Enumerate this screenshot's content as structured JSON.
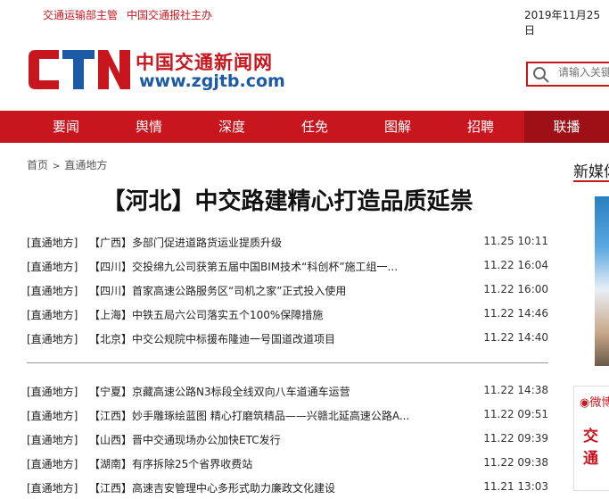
{
  "topbar": {
    "sponsor1": "交通运输部主管",
    "sponsor2": "中国交通报社主办",
    "date": "2019年11月25日"
  },
  "logo": {
    "ctn": "CTN",
    "name_cn": "中国交通新闻网",
    "url": "www.zgjtb.com"
  },
  "search": {
    "placeholder": "请输入关键"
  },
  "nav": {
    "items": [
      {
        "label": "要闻"
      },
      {
        "label": "舆情"
      },
      {
        "label": "深度"
      },
      {
        "label": "任免"
      },
      {
        "label": "图解"
      },
      {
        "label": "招聘"
      },
      {
        "label": "联播"
      }
    ]
  },
  "breadcrumb": {
    "home": "首页",
    "separator": ">",
    "current": "直通地方"
  },
  "article": {
    "title": "【河北】中交路建精心打造品质延祟"
  },
  "list1": [
    {
      "cat": "[直通地方]",
      "headline": "【广西】多部门促进道路货运业提质升级",
      "time": "11.25 10:11"
    },
    {
      "cat": "[直通地方]",
      "headline": "【四川】交投绵九公司获第五届中国BIM技术“科创杯”施工组一...",
      "time": "11.22 16:04"
    },
    {
      "cat": "[直通地方]",
      "headline": "【四川】首家高速公路服务区“司机之家”正式投入使用",
      "time": "11.22 16:00"
    },
    {
      "cat": "[直通地方]",
      "headline": "【上海】中铁五局六公司落实五个100%保障措施",
      "time": "11.22 14:46"
    },
    {
      "cat": "[直通地方]",
      "headline": "【北京】中交公规院中标援布隆迪一号国道改道项目",
      "time": "11.22 14:40"
    }
  ],
  "list2": [
    {
      "cat": "[直通地方]",
      "headline": "【宁夏】京藏高速公路N3标段全线双向八车道通车运营",
      "time": "11.22 14:38"
    },
    {
      "cat": "[直通地方]",
      "headline": "【江西】妙手雕琢绘蓝图 精心打磨筑精品——兴赣北延高速公路A...",
      "time": "11.22 09:51"
    },
    {
      "cat": "[直通地方]",
      "headline": "【山西】晋中交通现场办公加快ETC发行",
      "time": "11.22 09:39"
    },
    {
      "cat": "[直通地方]",
      "headline": "【湖南】有序拆除25个省界收费站",
      "time": "11.22 09:38"
    },
    {
      "cat": "[直通地方]",
      "headline": "【江西】高速吉安管理中心多形式助力廉政文化建设",
      "time": "11.21 13:03"
    }
  ],
  "sidebar": {
    "title": "新媒体",
    "weibo_label": "微博",
    "weibo_text": "交通"
  },
  "colors": {
    "brand_red": "#c8161e",
    "brand_blue": "#1c5aa6",
    "nav_active": "#9e0f16"
  }
}
